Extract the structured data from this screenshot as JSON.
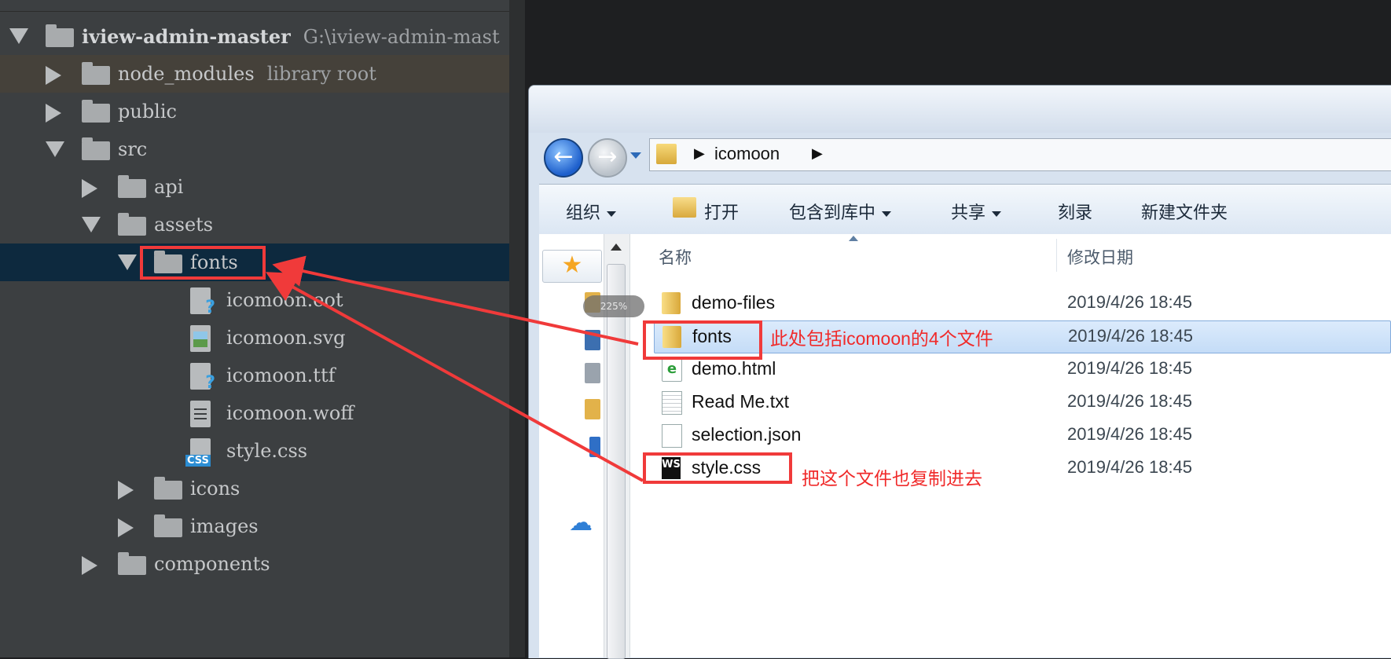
{
  "ide": {
    "tree": [
      {
        "indent": 0,
        "state": "expanded",
        "kind": "folder",
        "label": "iview-admin-master",
        "hint": "G:\\iview-admin-mast",
        "bold": true
      },
      {
        "indent": 1,
        "state": "collapsed",
        "kind": "folder",
        "label": "node_modules",
        "hint": "library root",
        "style": "lib"
      },
      {
        "indent": 1,
        "state": "collapsed",
        "kind": "folder",
        "label": "public"
      },
      {
        "indent": 1,
        "state": "expanded",
        "kind": "folder",
        "label": "src"
      },
      {
        "indent": 2,
        "state": "collapsed",
        "kind": "folder",
        "label": "api"
      },
      {
        "indent": 2,
        "state": "expanded",
        "kind": "folder",
        "label": "assets"
      },
      {
        "indent": 3,
        "state": "expanded",
        "kind": "folder",
        "label": "fonts",
        "style": "sel"
      },
      {
        "indent": 4,
        "state": "none",
        "kind": "file-unknown",
        "label": "icomoon.eot"
      },
      {
        "indent": 4,
        "state": "none",
        "kind": "file-image",
        "label": "icomoon.svg"
      },
      {
        "indent": 4,
        "state": "none",
        "kind": "file-unknown",
        "label": "icomoon.ttf"
      },
      {
        "indent": 4,
        "state": "none",
        "kind": "file-text",
        "label": "icomoon.woff"
      },
      {
        "indent": 4,
        "state": "none",
        "kind": "file-css",
        "label": "style.css"
      },
      {
        "indent": 3,
        "state": "collapsed",
        "kind": "folder",
        "label": "icons"
      },
      {
        "indent": 3,
        "state": "collapsed",
        "kind": "folder",
        "label": "images"
      },
      {
        "indent": 2,
        "state": "collapsed",
        "kind": "folder",
        "label": "components"
      }
    ]
  },
  "explorer": {
    "address": {
      "crumb": "icomoon"
    },
    "toolbar": {
      "organize": "组织",
      "open": "打开",
      "include_in_library": "包含到库中",
      "share": "共享",
      "burn": "刻录",
      "new_folder": "新建文件夹"
    },
    "columns": {
      "name": "名称",
      "modified": "修改日期"
    },
    "zoom": "225%",
    "files": [
      {
        "name": "demo-files",
        "date": "2019/4/26 18:45",
        "type": "folder"
      },
      {
        "name": "fonts",
        "date": "2019/4/26 18:45",
        "type": "folder",
        "selected": true
      },
      {
        "name": "demo.html",
        "date": "2019/4/26 18:45",
        "type": "html"
      },
      {
        "name": "Read Me.txt",
        "date": "2019/4/26 18:45",
        "type": "txt"
      },
      {
        "name": "selection.json",
        "date": "2019/4/26 18:45",
        "type": "json"
      },
      {
        "name": "style.css",
        "date": "2019/4/26 18:45",
        "type": "ws"
      }
    ]
  },
  "annotations": {
    "fonts_note": "此处包括icomoon的4个文件",
    "style_note": "把这个文件也复制进去",
    "color": "#f03a3a"
  }
}
